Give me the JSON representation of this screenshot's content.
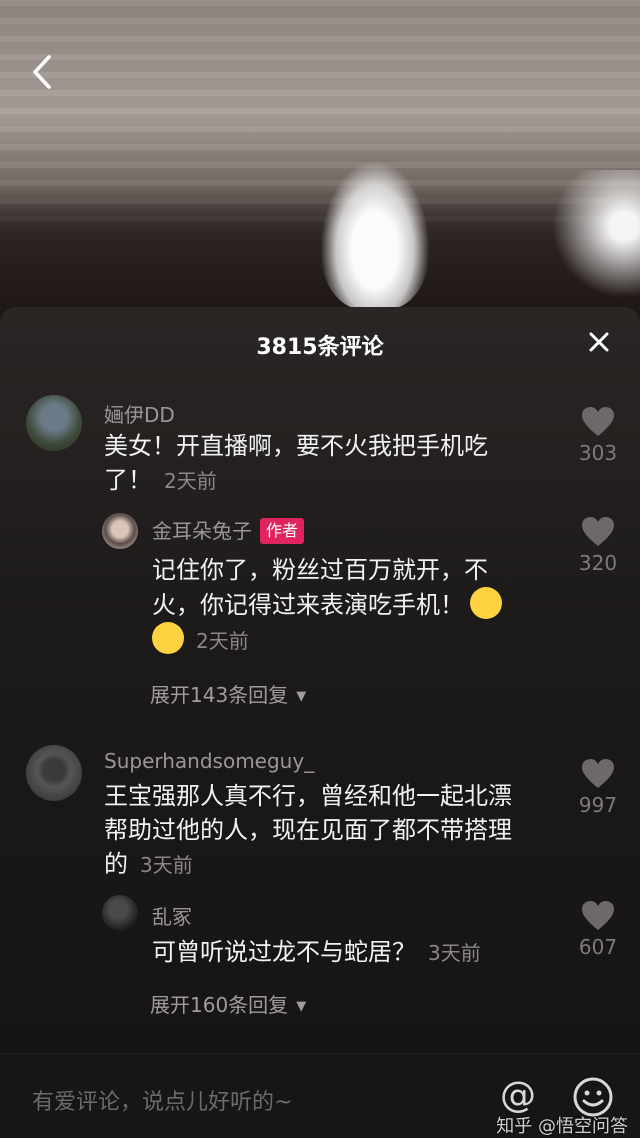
{
  "header": {
    "title": "3815条评论"
  },
  "comments": [
    {
      "username": "婳伊DD",
      "text_line1": "美女！开直播啊，要不火我把手机吃",
      "text_line2": "了！",
      "time": "2天前",
      "likes": "303",
      "reply": {
        "username": "金耳朵兔子",
        "badge": "作者",
        "text_line1": "记住你了，粉丝过百万就开，不",
        "text_line2": "火，你记得过来表演吃手机！",
        "time": "2天前",
        "likes": "320"
      },
      "expand": "展开143条回复"
    },
    {
      "username": "Superhandsomeguy_",
      "text_line1": "王宝强那人真不行，曾经和他一起北漂",
      "text_line2": "帮助过他的人，现在见面了都不带搭理",
      "text_line3": "的",
      "time": "3天前",
      "likes": "997",
      "reply": {
        "username": "乱冢",
        "text_line1": "可曾听说过龙不与蛇居？",
        "time": "3天前",
        "likes": "607"
      },
      "expand": "展开160条回复"
    }
  ],
  "input": {
    "placeholder": "有爱评论，说点儿好听的~",
    "at_symbol": "@"
  },
  "watermark": "知乎 @悟空问答",
  "icons": {
    "back": "chevron-left-icon",
    "close": "close-icon",
    "like": "heart-icon",
    "emoji": "smiley-icon"
  },
  "colors": {
    "author_badge": "#e0245e",
    "sheet_bg": "#1c1a19"
  }
}
